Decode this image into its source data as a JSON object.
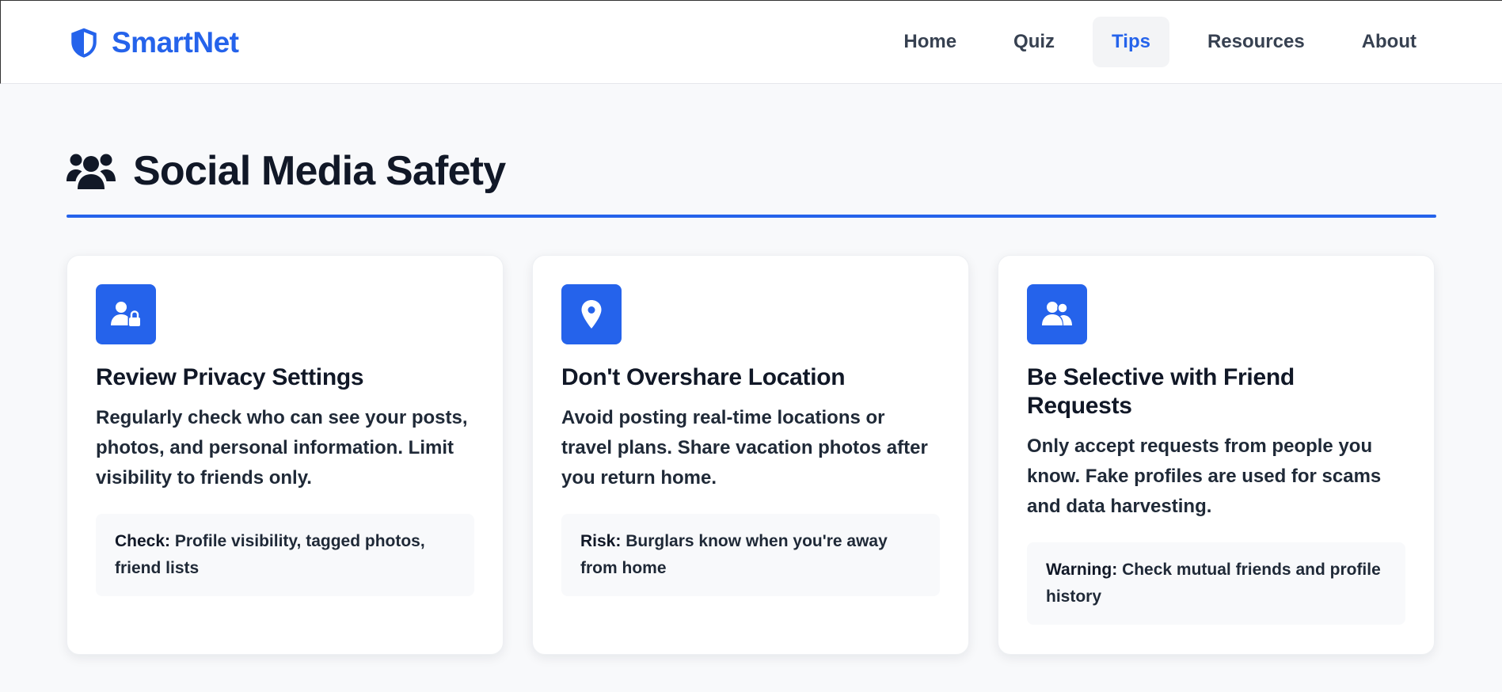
{
  "brand": {
    "name": "SmartNet",
    "logo_icon": "shield-icon",
    "color": "#2563eb"
  },
  "nav": {
    "items": [
      {
        "label": "Home",
        "active": false
      },
      {
        "label": "Quiz",
        "active": false
      },
      {
        "label": "Tips",
        "active": true
      },
      {
        "label": "Resources",
        "active": false
      },
      {
        "label": "About",
        "active": false
      }
    ]
  },
  "section": {
    "title": "Social Media Safety",
    "icon": "users-icon"
  },
  "cards": [
    {
      "icon": "user-lock-icon",
      "title": "Review Privacy Settings",
      "description": "Regularly check who can see your posts, photos, and personal information. Limit visibility to friends only.",
      "note_label": "Check:",
      "note_text": "Profile visibility, tagged photos, friend lists"
    },
    {
      "icon": "location-pin-icon",
      "title": "Don't Overshare Location",
      "description": "Avoid posting real-time locations or travel plans. Share vacation photos after you return home.",
      "note_label": "Risk:",
      "note_text": "Burglars know when you're away from home"
    },
    {
      "icon": "user-group-icon",
      "title": "Be Selective with Friend Requests",
      "description": "Only accept requests from people you know. Fake profiles are used for scams and data harvesting.",
      "note_label": "Warning:",
      "note_text": "Check mutual friends and profile history"
    }
  ],
  "colors": {
    "accent": "#2563eb",
    "background": "#f8f9fb",
    "text": "#111827"
  }
}
